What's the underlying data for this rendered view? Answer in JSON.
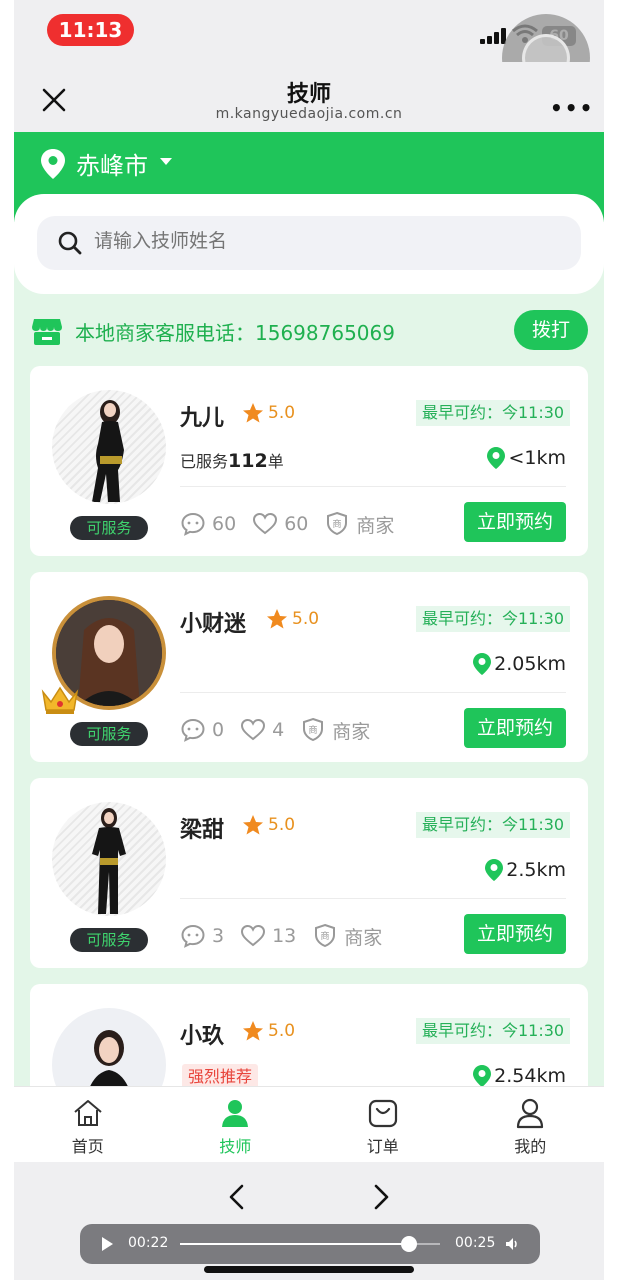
{
  "status_bar": {
    "time": "11:13",
    "battery": "60"
  },
  "nav": {
    "title": "技师",
    "url": "m.kangyuedaojia.com.cn",
    "more": "•••"
  },
  "header": {
    "city": "赤峰市"
  },
  "search": {
    "placeholder": "请输入技师姓名"
  },
  "service": {
    "text": "本地商家客服电话：15698765069",
    "dial_label": "拨打"
  },
  "technicians": [
    {
      "name": "九儿",
      "rating": "5.0",
      "earliest": "最早可约：今11:30",
      "served_prefix": "已服务",
      "served_count": "112",
      "served_suffix": "单",
      "distance": "<1km",
      "comments": "60",
      "likes": "60",
      "merchant": "商家",
      "status": "可服务",
      "book": "立即预约"
    },
    {
      "name": "小财迷",
      "rating": "5.0",
      "earliest": "最早可约：今11:30",
      "distance": "2.05km",
      "comments": "0",
      "likes": "4",
      "merchant": "商家",
      "status": "可服务",
      "book": "立即预约"
    },
    {
      "name": "梁甜",
      "rating": "5.0",
      "earliest": "最早可约：今11:30",
      "distance": "2.5km",
      "comments": "3",
      "likes": "13",
      "merchant": "商家",
      "status": "可服务",
      "book": "立即预约"
    },
    {
      "name": "小玖",
      "rating": "5.0",
      "earliest": "最早可约：今11:30",
      "recommend": "强烈推荐",
      "distance": "2.54km"
    }
  ],
  "tabs": [
    {
      "label": "首页",
      "icon": "home-icon"
    },
    {
      "label": "技师",
      "icon": "person-icon",
      "active": true
    },
    {
      "label": "订单",
      "icon": "bag-icon"
    },
    {
      "label": "我的",
      "icon": "user-icon"
    }
  ],
  "video": {
    "current": "00:22",
    "total": "00:25",
    "progress": 0.88
  },
  "colors": {
    "brand_green": "#1fc55a",
    "status_red": "#ef2f2f",
    "rating_orange": "#e8911f"
  }
}
